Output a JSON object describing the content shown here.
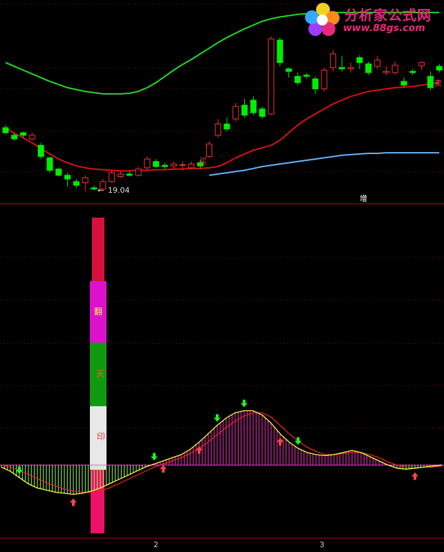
{
  "watermark": {
    "title": "分析家公式网",
    "url": "www.88gs.com"
  },
  "colors": {
    "background": "#000000",
    "up_candle": "#ff3030",
    "down_candle": "#00ee00",
    "upper_band": "#22dd22",
    "mid_band": "#dd1111",
    "lower_band": "#66b6ff",
    "grid": "#8a1010",
    "hist_pos": "#ff33cc",
    "hist_neg": "#99ff66",
    "osc_line1": "#ffff44",
    "osc_line2": "#ee2222",
    "arrow_up": "#ff4444",
    "arrow_down": "#22ee22"
  },
  "chart_data": [
    {
      "type": "candlestick",
      "panel": "price",
      "annotations": {
        "low_label": "19.04",
        "buy_marker": "买",
        "sell_marker": "卖",
        "increase_label": "增"
      },
      "open": [
        20.06,
        19.94,
        19.98,
        19.88,
        19.78,
        19.58,
        19.4,
        19.3,
        19.2,
        19.18,
        19.1,
        19.08,
        19.2,
        19.28,
        19.32,
        19.3,
        19.42,
        19.52,
        19.46,
        19.45,
        19.46,
        19.42,
        19.5,
        19.6,
        19.94,
        20.12,
        20.2,
        20.42,
        20.5,
        20.36,
        20.28,
        21.46,
        21.0,
        20.88,
        20.9,
        20.84,
        20.68,
        21.02,
        21.02,
        21.0,
        21.18,
        21.08,
        21.04,
        20.94,
        20.94,
        20.8,
        20.96,
        21.05,
        20.88,
        21.04
      ],
      "close": [
        19.98,
        19.88,
        19.94,
        19.94,
        19.6,
        19.38,
        19.3,
        19.24,
        19.14,
        19.26,
        19.08,
        19.2,
        19.34,
        19.32,
        19.3,
        19.4,
        19.56,
        19.44,
        19.44,
        19.48,
        19.47,
        19.48,
        19.45,
        19.8,
        20.12,
        20.04,
        20.4,
        20.26,
        20.3,
        20.24,
        21.48,
        21.1,
        20.96,
        20.78,
        20.88,
        20.68,
        20.98,
        21.24,
        21.0,
        21.02,
        21.1,
        20.94,
        21.14,
        20.96,
        21.06,
        20.74,
        20.94,
        21.1,
        20.7,
        20.98
      ],
      "high": [
        20.1,
        19.98,
        20.0,
        19.98,
        19.82,
        19.6,
        19.42,
        19.34,
        19.24,
        19.3,
        19.14,
        19.24,
        19.38,
        19.36,
        19.36,
        19.44,
        19.6,
        19.56,
        19.5,
        19.52,
        19.52,
        19.52,
        19.55,
        19.84,
        20.2,
        20.22,
        20.46,
        20.52,
        20.56,
        20.4,
        21.52,
        21.5,
        21.02,
        20.94,
        20.94,
        20.88,
        21.02,
        21.3,
        21.2,
        21.1,
        21.22,
        21.12,
        21.2,
        21.04,
        21.12,
        20.86,
        21.0,
        21.12,
        20.96,
        21.08
      ],
      "low": [
        19.96,
        19.86,
        19.9,
        19.86,
        19.56,
        19.34,
        19.28,
        19.12,
        19.1,
        19.04,
        19.06,
        19.06,
        19.18,
        19.26,
        19.28,
        19.28,
        19.38,
        19.42,
        19.4,
        19.4,
        19.38,
        19.4,
        19.4,
        19.58,
        19.9,
        20.0,
        20.16,
        20.22,
        20.26,
        20.2,
        20.26,
        21.04,
        20.86,
        20.74,
        20.84,
        20.6,
        20.64,
        20.96,
        20.96,
        20.94,
        21.0,
        20.9,
        21.0,
        20.9,
        20.9,
        20.7,
        20.9,
        20.98,
        20.66,
        20.94
      ],
      "series": [
        {
          "name": "upper",
          "values": [
            21.1,
            21.04,
            20.98,
            20.92,
            20.86,
            20.8,
            20.75,
            20.7,
            20.67,
            20.64,
            20.62,
            20.6,
            20.6,
            20.6,
            20.61,
            20.64,
            20.7,
            20.78,
            20.88,
            20.98,
            21.07,
            21.15,
            21.24,
            21.33,
            21.42,
            21.5,
            21.57,
            21.64,
            21.7,
            21.76,
            21.8,
            21.83,
            21.85,
            21.87,
            21.88,
            21.89,
            21.9,
            21.9,
            21.9,
            21.9,
            21.9,
            21.9,
            21.9,
            21.9,
            21.9,
            21.9,
            21.9,
            21.9,
            21.9,
            21.9
          ]
        },
        {
          "name": "mid",
          "values": [
            20.06,
            19.97,
            19.9,
            19.82,
            19.73,
            19.64,
            19.56,
            19.5,
            19.45,
            19.42,
            19.4,
            19.39,
            19.38,
            19.37,
            19.37,
            19.38,
            19.38,
            19.39,
            19.39,
            19.4,
            19.4,
            19.41,
            19.41,
            19.42,
            19.44,
            19.5,
            19.58,
            19.64,
            19.7,
            19.74,
            19.78,
            19.86,
            19.98,
            20.1,
            20.2,
            20.28,
            20.36,
            20.44,
            20.5,
            20.56,
            20.6,
            20.64,
            20.66,
            20.68,
            20.7,
            20.71,
            20.72,
            20.74,
            20.76,
            20.78
          ]
        },
        {
          "name": "lower",
          "values": [
            18.9,
            18.93,
            18.97,
            19.0,
            19.03,
            19.06,
            19.09,
            19.12,
            19.14,
            19.16,
            19.17,
            19.18,
            19.19,
            19.19,
            19.2,
            19.2,
            19.21,
            19.21,
            19.22,
            19.23,
            19.24,
            19.26,
            19.28,
            19.3,
            19.32,
            19.34,
            19.36,
            19.38,
            19.41,
            19.44,
            19.46,
            19.48,
            19.5,
            19.52,
            19.54,
            19.56,
            19.58,
            19.6,
            19.62,
            19.63,
            19.64,
            19.65,
            19.65,
            19.66,
            19.66,
            19.66,
            19.66,
            19.66,
            19.66,
            19.66
          ]
        }
      ],
      "ylim": [
        18.9,
        22.1
      ]
    },
    {
      "type": "line",
      "panel": "oscillator",
      "signal_labels": [
        "翻",
        "天",
        "印"
      ],
      "x_tick_labels": [
        "2",
        "3"
      ],
      "series": [
        {
          "name": "osc",
          "values": [
            -0.02,
            -0.06,
            -0.12,
            -0.18,
            -0.22,
            -0.24,
            -0.26,
            -0.27,
            -0.28,
            -0.27,
            -0.25,
            -0.22,
            -0.18,
            -0.14,
            -0.1,
            -0.06,
            -0.02,
            0.01,
            0.04,
            0.07,
            0.1,
            0.15,
            0.22,
            0.3,
            0.38,
            0.45,
            0.5,
            0.52,
            0.52,
            0.48,
            0.4,
            0.3,
            0.22,
            0.16,
            0.12,
            0.1,
            0.09,
            0.1,
            0.12,
            0.14,
            0.12,
            0.08,
            0.04,
            0.0,
            -0.03,
            -0.04,
            -0.03,
            -0.02,
            -0.01,
            0.0
          ]
        },
        {
          "name": "signal",
          "values": [
            0.0,
            -0.02,
            -0.05,
            -0.09,
            -0.13,
            -0.17,
            -0.2,
            -0.23,
            -0.25,
            -0.26,
            -0.26,
            -0.25,
            -0.22,
            -0.18,
            -0.14,
            -0.1,
            -0.06,
            -0.02,
            0.01,
            0.04,
            0.07,
            0.11,
            0.16,
            0.22,
            0.29,
            0.36,
            0.42,
            0.47,
            0.5,
            0.5,
            0.46,
            0.38,
            0.3,
            0.23,
            0.17,
            0.13,
            0.1,
            0.1,
            0.11,
            0.12,
            0.12,
            0.1,
            0.07,
            0.03,
            0.0,
            -0.02,
            -0.03,
            -0.02,
            -0.02,
            -0.01
          ]
        }
      ],
      "up_arrows_at": [
        8,
        18,
        22,
        31,
        46
      ],
      "down_arrows_at": [
        2,
        17,
        24,
        27,
        33
      ],
      "ylim": [
        -0.7,
        2.5
      ]
    }
  ]
}
